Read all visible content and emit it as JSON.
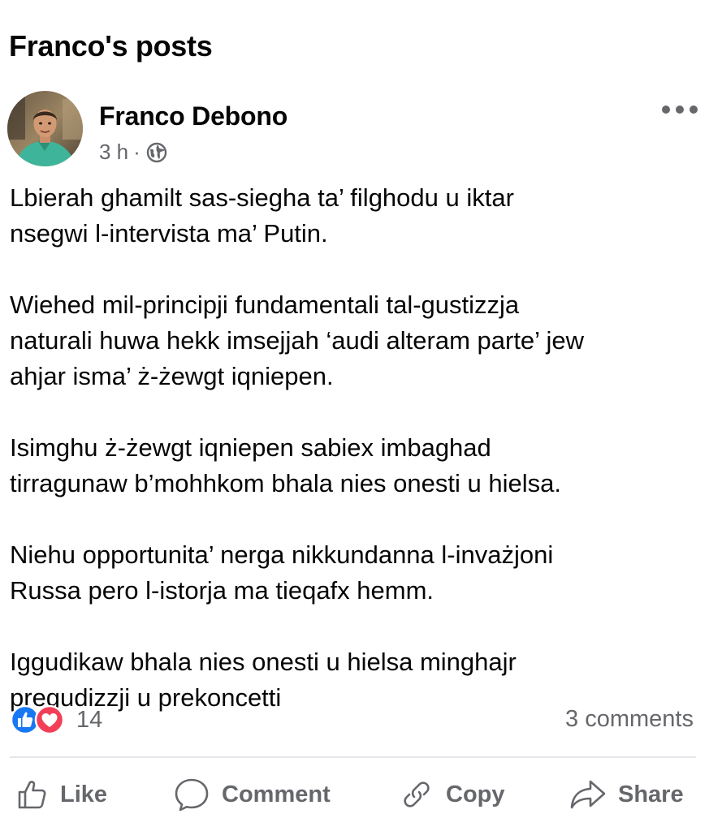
{
  "page": {
    "title": "Franco's posts"
  },
  "post": {
    "author": "Franco Debono",
    "time": "3 h",
    "separator": "·",
    "privacy_icon": "globe-icon",
    "paragraphs": [
      "Lbierah ghamilt sas-siegha ta’ filghodu  u iktar\nnsegwi l-intervista ma’ Putin.",
      "Wiehed mil-principji fundamentali tal-gustizzja\nnaturali huwa hekk imsejjah ‘audi alteram parte’ jew\nahjar isma’ ż-żewgt iqniepen.",
      "Isimghu ż-żewgt iqniepen sabiex imbaghad\ntirragunaw b’mohhkom bhala nies onesti u hielsa.",
      "Niehu opportunita’ nerga nikkundanna l-invażjoni\nRussa pero l-istorja ma tieqafx hemm.",
      "Iggudikaw bhala nies onesti u hielsa minghajr\npregudizzji u prekoncetti"
    ],
    "reactions": {
      "types": [
        "like",
        "love"
      ],
      "count": "14"
    },
    "comments_label": "3 comments"
  },
  "actions": {
    "like": "Like",
    "comment": "Comment",
    "copy": "Copy",
    "share": "Share"
  },
  "colors": {
    "text": "#050505",
    "secondary": "#65676b",
    "like_blue": "#1877f2",
    "love_red": "#f33e58",
    "divider": "#e4e6eb"
  }
}
